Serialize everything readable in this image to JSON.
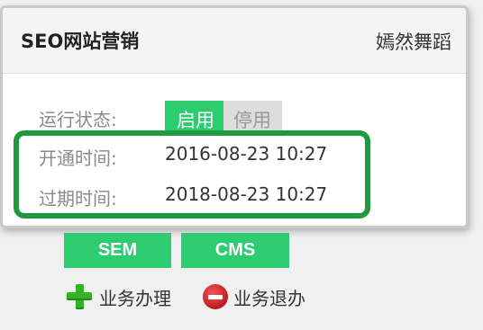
{
  "card": {
    "title": "SEO网站营销",
    "user": "嫣然舞蹈"
  },
  "status": {
    "label": "运行状态:",
    "on_label": "启用",
    "off_label": "停用"
  },
  "open_time": {
    "label": "开通时间:",
    "value": "2016-08-23 10:27"
  },
  "expire_time": {
    "label": "过期时间:",
    "value": "2018-08-23 10:27"
  },
  "tags": [
    "SEM",
    "CMS"
  ],
  "actions": {
    "handle_label": "业务办理",
    "handle_icon": "plus-icon",
    "cancel_label": "业务退办",
    "cancel_icon": "minus-circle-icon"
  },
  "colors": {
    "accent_green": "#2ecc71",
    "highlight_border": "#1f9a3e",
    "cancel_red": "#c0181f"
  }
}
